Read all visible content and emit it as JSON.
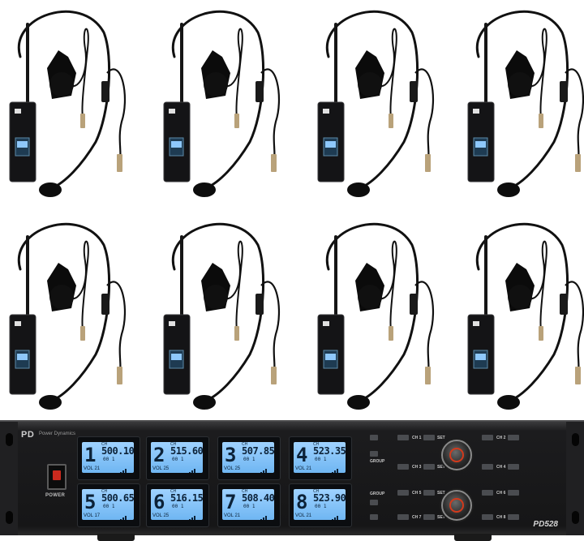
{
  "product": {
    "brand": "Power Dynamics",
    "model": "PD528",
    "power_label": "POWER"
  },
  "kits": {
    "count": 8,
    "items": [
      {
        "name": "kit-1"
      },
      {
        "name": "kit-2"
      },
      {
        "name": "kit-3"
      },
      {
        "name": "kit-4"
      },
      {
        "name": "kit-5"
      },
      {
        "name": "kit-6"
      },
      {
        "name": "kit-7"
      },
      {
        "name": "kit-8"
      }
    ]
  },
  "receiver": {
    "channels": [
      {
        "number": "1",
        "freq": "500.100",
        "vol": "21"
      },
      {
        "number": "2",
        "freq": "515.600",
        "vol": "25"
      },
      {
        "number": "3",
        "freq": "507.850",
        "vol": "25"
      },
      {
        "number": "4",
        "freq": "523.350",
        "vol": "21"
      },
      {
        "number": "5",
        "freq": "500.650",
        "vol": "17"
      },
      {
        "number": "6",
        "freq": "516.150",
        "vol": "25"
      },
      {
        "number": "7",
        "freq": "508.400",
        "vol": "21"
      },
      {
        "number": "8",
        "freq": "523.900",
        "vol": "21"
      }
    ],
    "ch_label": "CH",
    "vol_label": "VOL",
    "mhz_label": "MHz",
    "group_value": "00 1",
    "controls": {
      "group_label": "GROUP",
      "set_label": "SET",
      "ch_labels": [
        "CH 1",
        "CH 2",
        "CH 3",
        "CH 4",
        "CH 5",
        "CH 6",
        "CH 7",
        "CH 8"
      ]
    }
  },
  "colors": {
    "chassis": "#1c1c1e",
    "lcd": "#8ec8fb",
    "lcd_text": "#0c2238",
    "knob_accent": "#d23a1c",
    "power_switch": "#cc2a1e"
  }
}
